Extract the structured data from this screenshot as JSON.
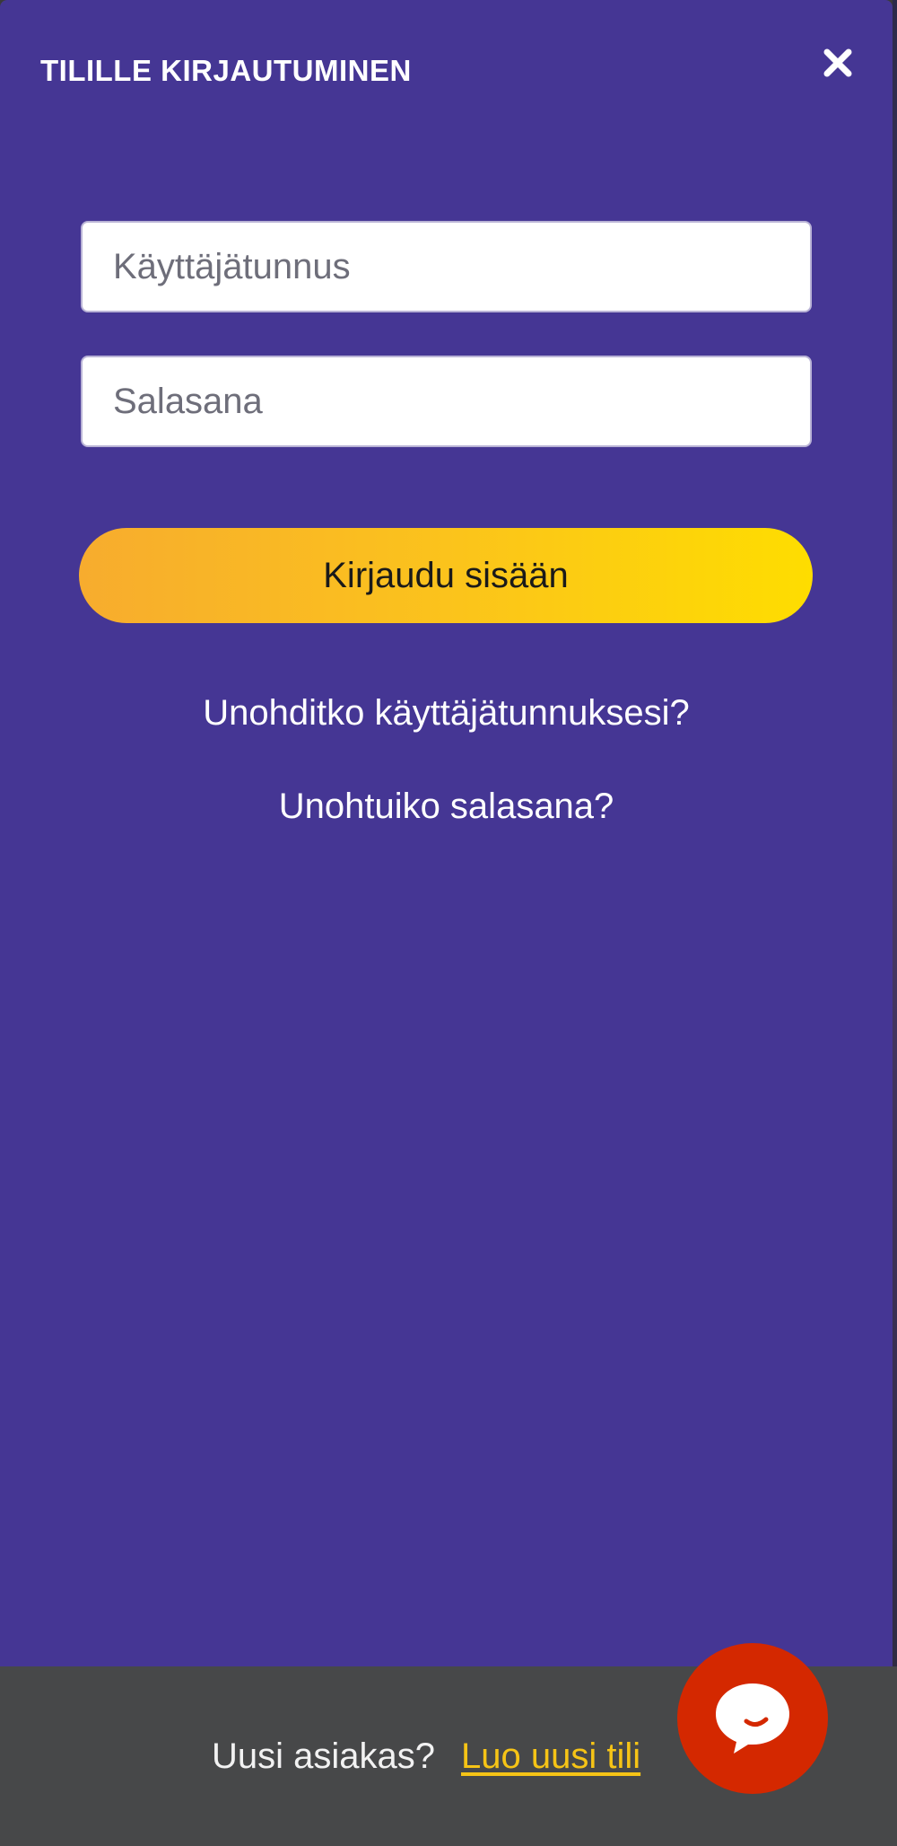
{
  "header": {
    "title": "TILILLE KIRJAUTUMINEN",
    "close_icon": "close-icon"
  },
  "form": {
    "username_placeholder": "Käyttäjätunnus",
    "username_value": "",
    "password_placeholder": "Salasana",
    "password_value": "",
    "login_label": "Kirjaudu sisään"
  },
  "links": {
    "forgot_username": "Unohditko käyttäjätunnuksesi?",
    "forgot_password": "Unohtuiko salasana?"
  },
  "footer": {
    "new_customer_text": "Uusi asiakas?",
    "create_account_link": "Luo uusi tili",
    "chat_icon": "chat-bubble-icon"
  },
  "colors": {
    "panel_bg": "#453694",
    "button_gradient_start": "#f7ac2e",
    "button_gradient_end": "#fedd00",
    "footer_bg": "#474849",
    "link_accent": "#f6c416",
    "chat_button": "#d42800"
  }
}
